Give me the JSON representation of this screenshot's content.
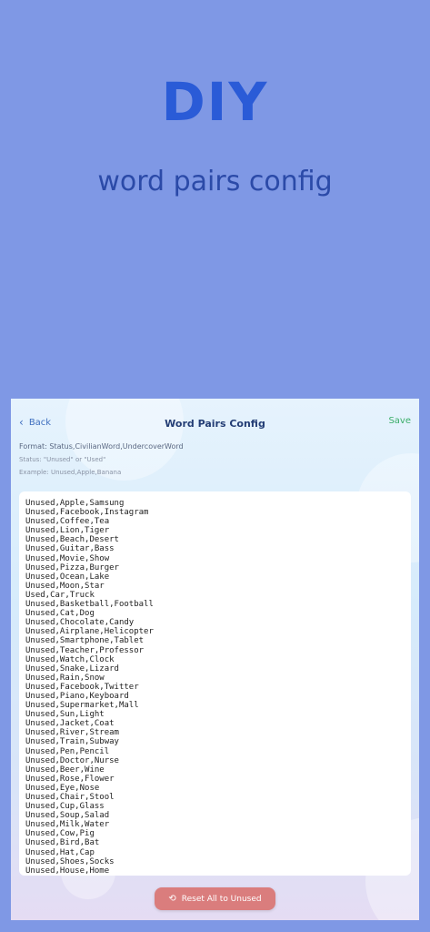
{
  "hero": {
    "title": "DIY",
    "subtitle": "word pairs config"
  },
  "navbar": {
    "back_label": "Back",
    "title": "Word Pairs Config",
    "save_label": "Save"
  },
  "info": {
    "format": "Format: Status,CivilianWord,UndercoverWord",
    "status": "Status: \"Unused\" or \"Used\"",
    "example": "Example: Unused,Apple,Banana"
  },
  "editor": {
    "lines": [
      "Unused,Apple,Samsung",
      "Unused,Facebook,Instagram",
      "Unused,Coffee,Tea",
      "Unused,Lion,Tiger",
      "Unused,Beach,Desert",
      "Unused,Guitar,Bass",
      "Unused,Movie,Show",
      "Unused,Pizza,Burger",
      "Unused,Ocean,Lake",
      "Unused,Moon,Star",
      "Used,Car,Truck",
      "Unused,Basketball,Football",
      "Unused,Cat,Dog",
      "Unused,Chocolate,Candy",
      "Unused,Airplane,Helicopter",
      "Unused,Smartphone,Tablet",
      "Unused,Teacher,Professor",
      "Unused,Watch,Clock",
      "Unused,Snake,Lizard",
      "Unused,Rain,Snow",
      "Unused,Facebook,Twitter",
      "Unused,Piano,Keyboard",
      "Unused,Supermarket,Mall",
      "Unused,Sun,Light",
      "Unused,Jacket,Coat",
      "Unused,River,Stream",
      "Unused,Train,Subway",
      "Unused,Pen,Pencil",
      "Unused,Doctor,Nurse",
      "Unused,Beer,Wine",
      "Unused,Rose,Flower",
      "Unused,Eye,Nose",
      "Unused,Chair,Stool",
      "Unused,Cup,Glass",
      "Unused,Soup,Salad",
      "Unused,Milk,Water",
      "Unused,Cow,Pig",
      "Unused,Bird,Bat",
      "Unused,Hat,Cap",
      "Unused,Shoes,Socks",
      "Unused,House,Home"
    ]
  },
  "reset": {
    "label": "Reset All to Unused",
    "icon": "reset-icon"
  },
  "colors": {
    "background": "#7f98e5",
    "hero_title": "#2a5bd7",
    "save": "#3cae6a",
    "reset_button": "#da7d7d"
  }
}
